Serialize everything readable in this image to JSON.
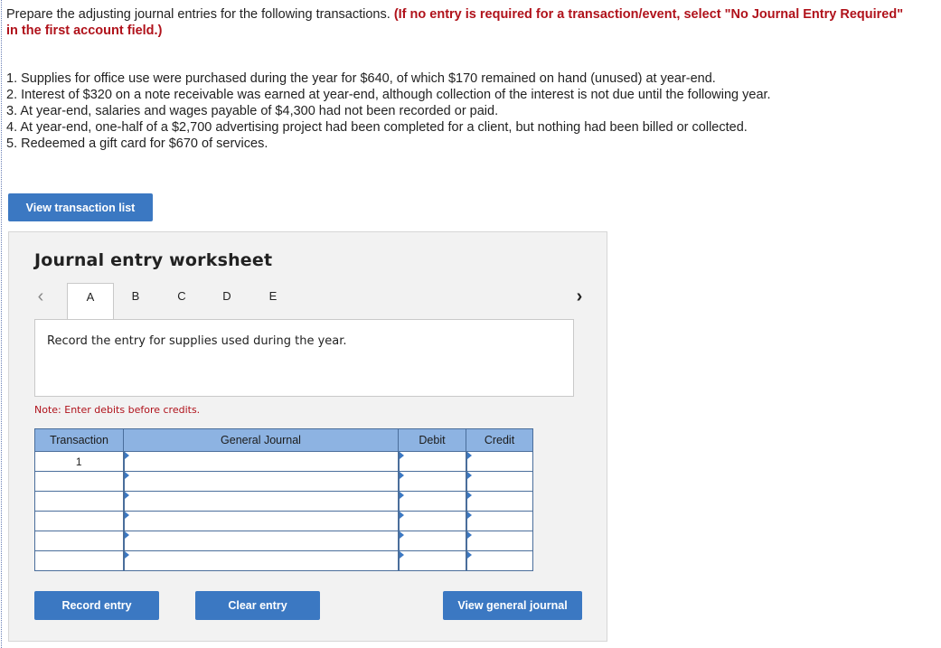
{
  "intro": {
    "text": "Prepare the adjusting journal entries for the following transactions.",
    "emphasis": "(If no entry is required for a transaction/event, select \"No Journal Entry Required\" in the first account field.)"
  },
  "transactions": [
    "1. Supplies for office use were purchased during the year for $640, of which $170 remained on hand (unused) at year-end.",
    "2. Interest of $320 on a note receivable was earned at year-end, although collection of the interest is not due until the following year.",
    "3. At year-end, salaries and wages payable of $4,300 had not been recorded or paid.",
    "4. At year-end, one-half of a $2,700 advertising project had been completed for a client, but nothing had been billed or collected.",
    "5. Redeemed a gift card for $670 of services."
  ],
  "buttons": {
    "view_transaction_list": "View transaction list",
    "record_entry": "Record entry",
    "clear_entry": "Clear entry",
    "view_general_journal": "View general journal"
  },
  "worksheet": {
    "title": "Journal entry worksheet",
    "tabs": [
      "A",
      "B",
      "C",
      "D",
      "E"
    ],
    "active_tab": "A",
    "instruction": "Record the entry for supplies used during the year.",
    "note": "Note: Enter debits before credits."
  },
  "journal": {
    "headers": {
      "transaction": "Transaction",
      "general_journal": "General Journal",
      "debit": "Debit",
      "credit": "Credit"
    },
    "rows": [
      {
        "transaction": "1"
      },
      {
        "transaction": ""
      },
      {
        "transaction": ""
      },
      {
        "transaction": ""
      },
      {
        "transaction": ""
      },
      {
        "transaction": ""
      }
    ]
  },
  "colors": {
    "button_blue": "#3b78c2",
    "header_blue": "#8db3e2",
    "emphasis_red": "#b0121b"
  }
}
